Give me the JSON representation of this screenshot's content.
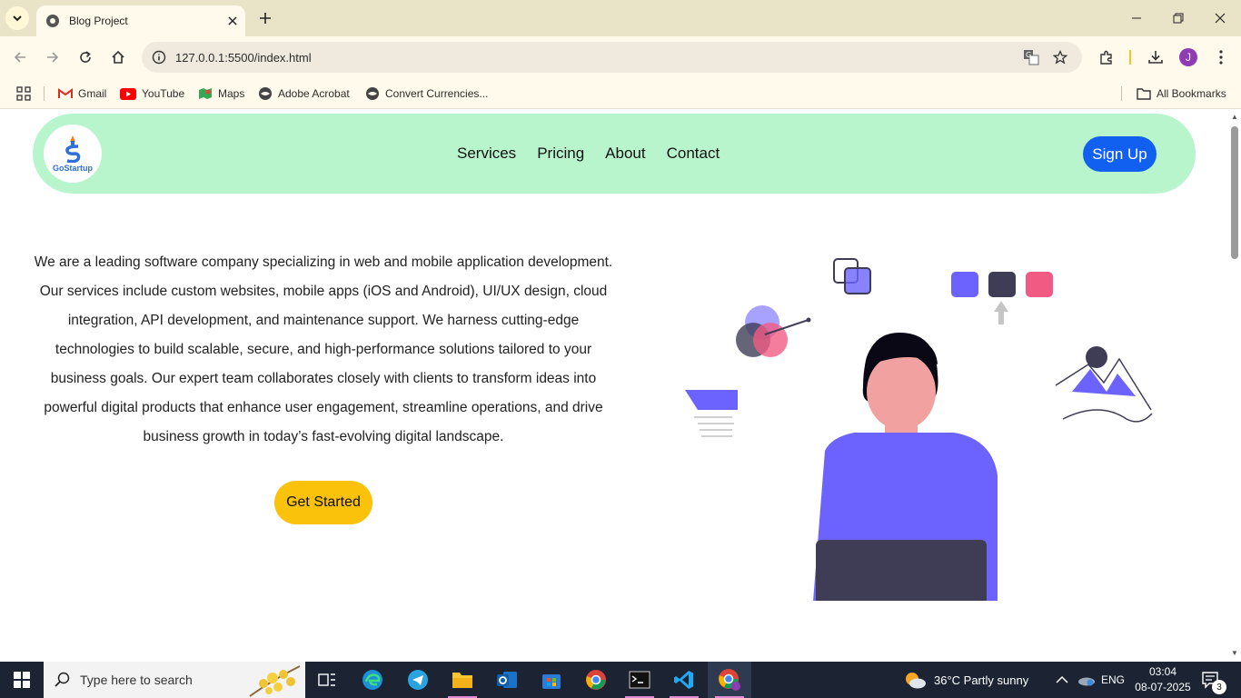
{
  "browser": {
    "tab_title": "Blog Project",
    "url": "127.0.0.1:5500/index.html",
    "bookmarks": [
      {
        "label": "Gmail",
        "icon": "gmail-icon"
      },
      {
        "label": "YouTube",
        "icon": "youtube-icon"
      },
      {
        "label": "Maps",
        "icon": "maps-icon"
      },
      {
        "label": "Adobe Acrobat",
        "icon": "globe-icon"
      },
      {
        "label": "Convert Currencies...",
        "icon": "globe-icon"
      }
    ],
    "all_bookmarks": "All Bookmarks",
    "profile_initial": "J"
  },
  "site": {
    "logo_text": "GoStartup",
    "nav": [
      "Services",
      "Pricing",
      "About",
      "Contact"
    ],
    "signup": "Sign Up",
    "hero_text": "We are a leading software company specializing in web and mobile application development. Our services include custom websites, mobile apps (iOS and Android), UI/UX design, cloud integration, API development, and maintenance support. We harness cutting-edge technologies to build scalable, secure, and high-performance solutions tailored to your business goals. Our expert team collaborates closely with clients to transform ideas into powerful digital products that enhance user engagement, streamline operations, and drive business growth in today’s fast-evolving digital landscape.",
    "cta": "Get Started",
    "colors": {
      "nav_bg": "#b9f5cc",
      "signup": "#1160f0",
      "cta": "#fbc20b",
      "accent": "#6c63ff"
    }
  },
  "taskbar": {
    "search_placeholder": "Type here to search",
    "weather": "36°C  Partly sunny",
    "lang": "ENG",
    "time": "03:04",
    "date": "08-07-2025",
    "notifications": "3"
  }
}
